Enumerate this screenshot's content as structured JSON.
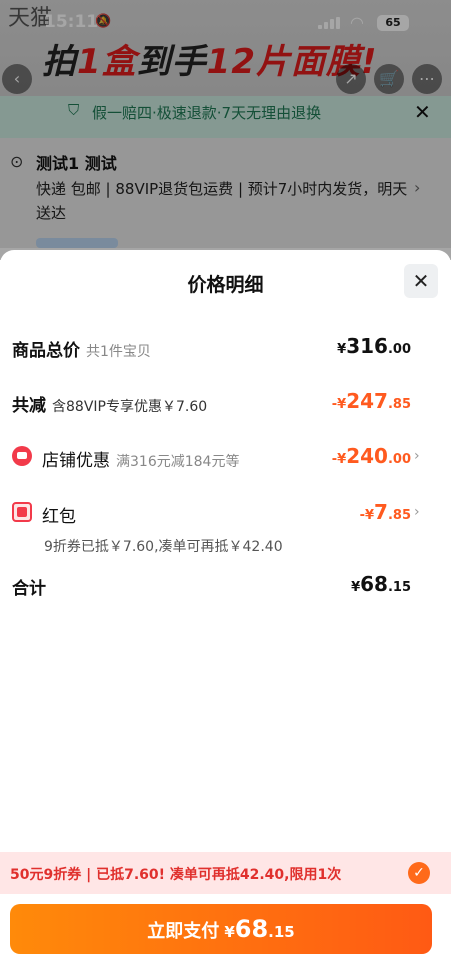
{
  "status_bar": {
    "time": "15:11",
    "battery": "65"
  },
  "banner": {
    "brand": "天猫",
    "promo_a": "拍",
    "promo_b": "1盒",
    "promo_c": "到手",
    "promo_d": "12片面膜!"
  },
  "guarantee": {
    "text": "假一赔四·极速退款·7天无理由退换"
  },
  "address": {
    "name": "测试1 测试",
    "line1": "快递 包邮 | 88VIP退货包运费 | 预计7小时内发货，明天",
    "line2": "送达"
  },
  "sheet": {
    "title": "价格明细",
    "rows": {
      "total_goods": {
        "label": "商品总价",
        "sub": "共1件宝贝",
        "yen": "¥",
        "int": "316",
        "dec": ".00"
      },
      "total_discount": {
        "label": "共减",
        "sub": "含88VIP专享优惠￥7.60",
        "yen": "-¥",
        "int": "247",
        "dec": ".85"
      },
      "shop_discount": {
        "label": "店铺优惠",
        "sub": "满316元减184元等",
        "yen": "-¥",
        "int": "240",
        "dec": ".00"
      },
      "red_packet": {
        "label": "红包",
        "yen": "-¥",
        "int": "7",
        "dec": ".85",
        "note": "9折券已抵￥7.60,凑单可再抵￥42.40"
      },
      "sum": {
        "label": "合计",
        "yen": "¥",
        "int": "68",
        "dec": ".15"
      }
    }
  },
  "coupon_bar": {
    "text": "50元9折券 | 已抵7.60! 凑单可再抵42.40,限用1次"
  },
  "pay_button": {
    "label": "立即支付",
    "yen": "¥",
    "int": "68",
    "dec": ".15"
  },
  "colors": {
    "accent": "#ff5a1f",
    "red": "#f23a4a",
    "guarantee_green": "#1f7a55"
  }
}
